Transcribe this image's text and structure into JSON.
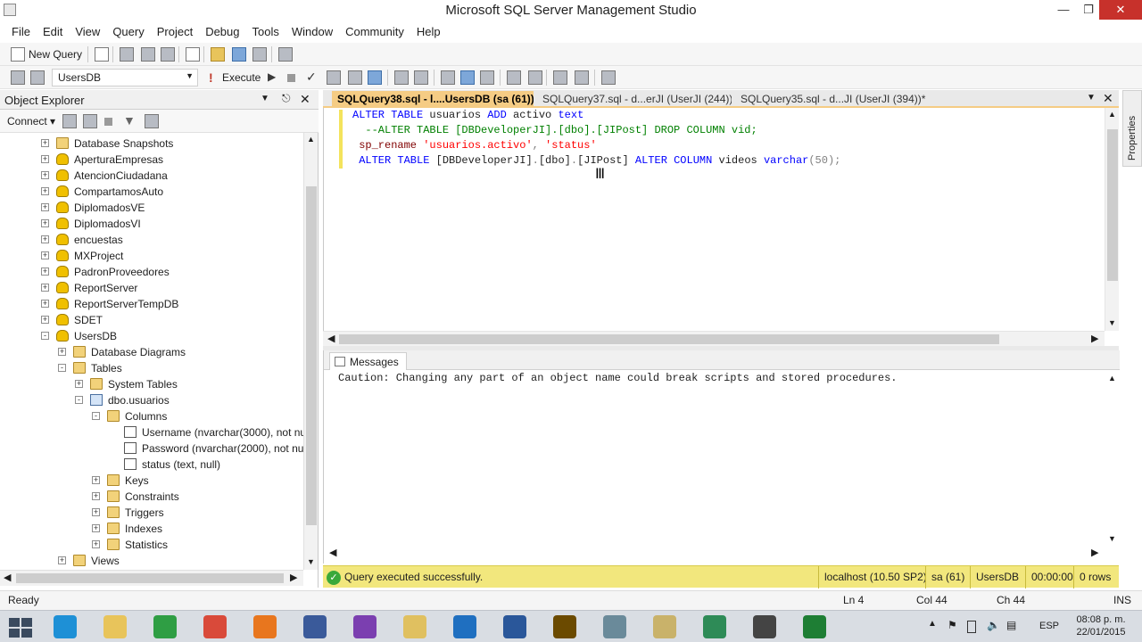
{
  "window": {
    "title": "Microsoft SQL Server Management Studio"
  },
  "menu": [
    "File",
    "Edit",
    "View",
    "Query",
    "Project",
    "Debug",
    "Tools",
    "Window",
    "Community",
    "Help"
  ],
  "toolbar1": {
    "new_query": "New Query"
  },
  "toolbar2": {
    "database": "UsersDB",
    "execute": "Execute"
  },
  "object_explorer": {
    "title": "Object Explorer",
    "connect": "Connect",
    "tree": [
      {
        "label": "Database Snapshots",
        "icon": "folder",
        "level": 0,
        "expander": "+"
      },
      {
        "label": "AperturaEmpresas",
        "icon": "database",
        "level": 0,
        "expander": "+"
      },
      {
        "label": "AtencionCiudadana",
        "icon": "database",
        "level": 0,
        "expander": "+"
      },
      {
        "label": "CompartamosAuto",
        "icon": "database",
        "level": 0,
        "expander": "+"
      },
      {
        "label": "DiplomadosVE",
        "icon": "database",
        "level": 0,
        "expander": "+"
      },
      {
        "label": "DiplomadosVI",
        "icon": "database",
        "level": 0,
        "expander": "+"
      },
      {
        "label": "encuestas",
        "icon": "database",
        "level": 0,
        "expander": "+"
      },
      {
        "label": "MXProject",
        "icon": "database",
        "level": 0,
        "expander": "+"
      },
      {
        "label": "PadronProveedores",
        "icon": "database",
        "level": 0,
        "expander": "+"
      },
      {
        "label": "ReportServer",
        "icon": "database",
        "level": 0,
        "expander": "+"
      },
      {
        "label": "ReportServerTempDB",
        "icon": "database",
        "level": 0,
        "expander": "+"
      },
      {
        "label": "SDET",
        "icon": "database",
        "level": 0,
        "expander": "+"
      },
      {
        "label": "UsersDB",
        "icon": "database",
        "level": 0,
        "expander": "-"
      },
      {
        "label": "Database Diagrams",
        "icon": "folder",
        "level": 1,
        "expander": "+"
      },
      {
        "label": "Tables",
        "icon": "folder",
        "level": 1,
        "expander": "-"
      },
      {
        "label": "System Tables",
        "icon": "folder",
        "level": 2,
        "expander": "+"
      },
      {
        "label": "dbo.usuarios",
        "icon": "table",
        "level": 2,
        "expander": "-"
      },
      {
        "label": "Columns",
        "icon": "folder",
        "level": 3,
        "expander": "-"
      },
      {
        "label": "Username (nvarchar(3000), not nul",
        "icon": "column",
        "level": 4,
        "expander": ""
      },
      {
        "label": "Password (nvarchar(2000), not nul",
        "icon": "column",
        "level": 4,
        "expander": ""
      },
      {
        "label": "status (text, null)",
        "icon": "column",
        "level": 4,
        "expander": ""
      },
      {
        "label": "Keys",
        "icon": "folder",
        "level": 3,
        "expander": "+"
      },
      {
        "label": "Constraints",
        "icon": "folder",
        "level": 3,
        "expander": "+"
      },
      {
        "label": "Triggers",
        "icon": "folder",
        "level": 3,
        "expander": "+"
      },
      {
        "label": "Indexes",
        "icon": "folder",
        "level": 3,
        "expander": "+"
      },
      {
        "label": "Statistics",
        "icon": "folder",
        "level": 3,
        "expander": "+"
      },
      {
        "label": "Views",
        "icon": "folder",
        "level": 1,
        "expander": "+"
      }
    ]
  },
  "tabs": [
    {
      "label": "SQLQuery38.sql - l....UsersDB (sa (61))*",
      "active": true
    },
    {
      "label": "SQLQuery37.sql - d...erJI (UserJI (244))",
      "active": false
    },
    {
      "label": "SQLQuery35.sql - d...JI (UserJI (394))*",
      "active": false
    }
  ],
  "editor": {
    "lines": [
      [
        {
          "t": "ALTER TABLE ",
          "c": "kw"
        },
        {
          "t": "usuarios ",
          "c": ""
        },
        {
          "t": "ADD ",
          "c": "kw"
        },
        {
          "t": "activo ",
          "c": ""
        },
        {
          "t": "text",
          "c": "kw"
        }
      ],
      [
        {
          "t": "  --ALTER TABLE [DBDeveloperJI].[dbo].[JIPost] DROP COLUMN vid;",
          "c": "cmt"
        }
      ],
      [
        {
          "t": " sp_rename ",
          "c": "fn"
        },
        {
          "t": "'usuarios.activo'",
          "c": "str"
        },
        {
          "t": ", ",
          "c": "gr"
        },
        {
          "t": "'status'",
          "c": "str"
        }
      ],
      [
        {
          "t": " ALTER TABLE ",
          "c": "kw"
        },
        {
          "t": "[DBDeveloperJI]",
          "c": ""
        },
        {
          "t": ".",
          "c": "gr"
        },
        {
          "t": "[dbo]",
          "c": ""
        },
        {
          "t": ".",
          "c": "gr"
        },
        {
          "t": "[JIPost] ",
          "c": ""
        },
        {
          "t": "ALTER COLUMN ",
          "c": "kw"
        },
        {
          "t": "videos ",
          "c": ""
        },
        {
          "t": "varchar",
          "c": "kw"
        },
        {
          "t": "(50);",
          "c": "gr"
        }
      ]
    ]
  },
  "results": {
    "tab": "Messages",
    "message": "Caution: Changing any part of an object name could break scripts and stored procedures."
  },
  "query_status": {
    "message": "Query executed successfully.",
    "server": "localhost (10.50 SP2)",
    "user": "sa (61)",
    "database": "UsersDB",
    "elapsed": "00:00:00",
    "rows": "0 rows"
  },
  "properties_tab": "Properties",
  "statusbar": {
    "ready": "Ready",
    "ln": "Ln 4",
    "col": "Col 44",
    "ch": "Ch 44",
    "mode": "INS"
  },
  "taskbar": {
    "apps": [
      "internet-explorer",
      "file-explorer",
      "store",
      "chrome",
      "firefox",
      "network-tool",
      "visual-studio",
      "folder",
      "outlook",
      "word",
      "fireworks",
      "notepad",
      "ssms",
      "excel-tool",
      "tools",
      "camtasia"
    ],
    "language": "ESP",
    "time": "08:08 p. m.",
    "date": "22/01/2015"
  },
  "colors": {
    "accent_tab": "#f5cc84",
    "status_bar": "#f2e77d",
    "keyword": "#0000ff",
    "string": "#ff0000",
    "comment": "#008000"
  }
}
